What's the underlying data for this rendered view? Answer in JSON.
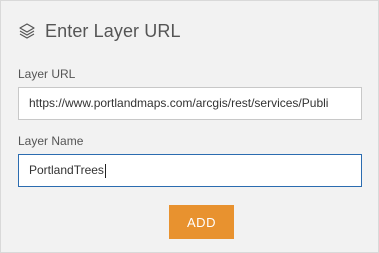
{
  "header": {
    "icon": "layers-icon",
    "title": "Enter Layer URL"
  },
  "form": {
    "layer_url_label": "Layer URL",
    "layer_url_value": "https://www.portlandmaps.com/arcgis/rest/services/Publi",
    "layer_name_label": "Layer Name",
    "layer_name_value": "PortlandTrees"
  },
  "actions": {
    "add_label": "ADD"
  },
  "colors": {
    "panel_background": "#f2f2f2",
    "add_button": "#e8922f",
    "focused_input_border": "#2b6cb0"
  }
}
